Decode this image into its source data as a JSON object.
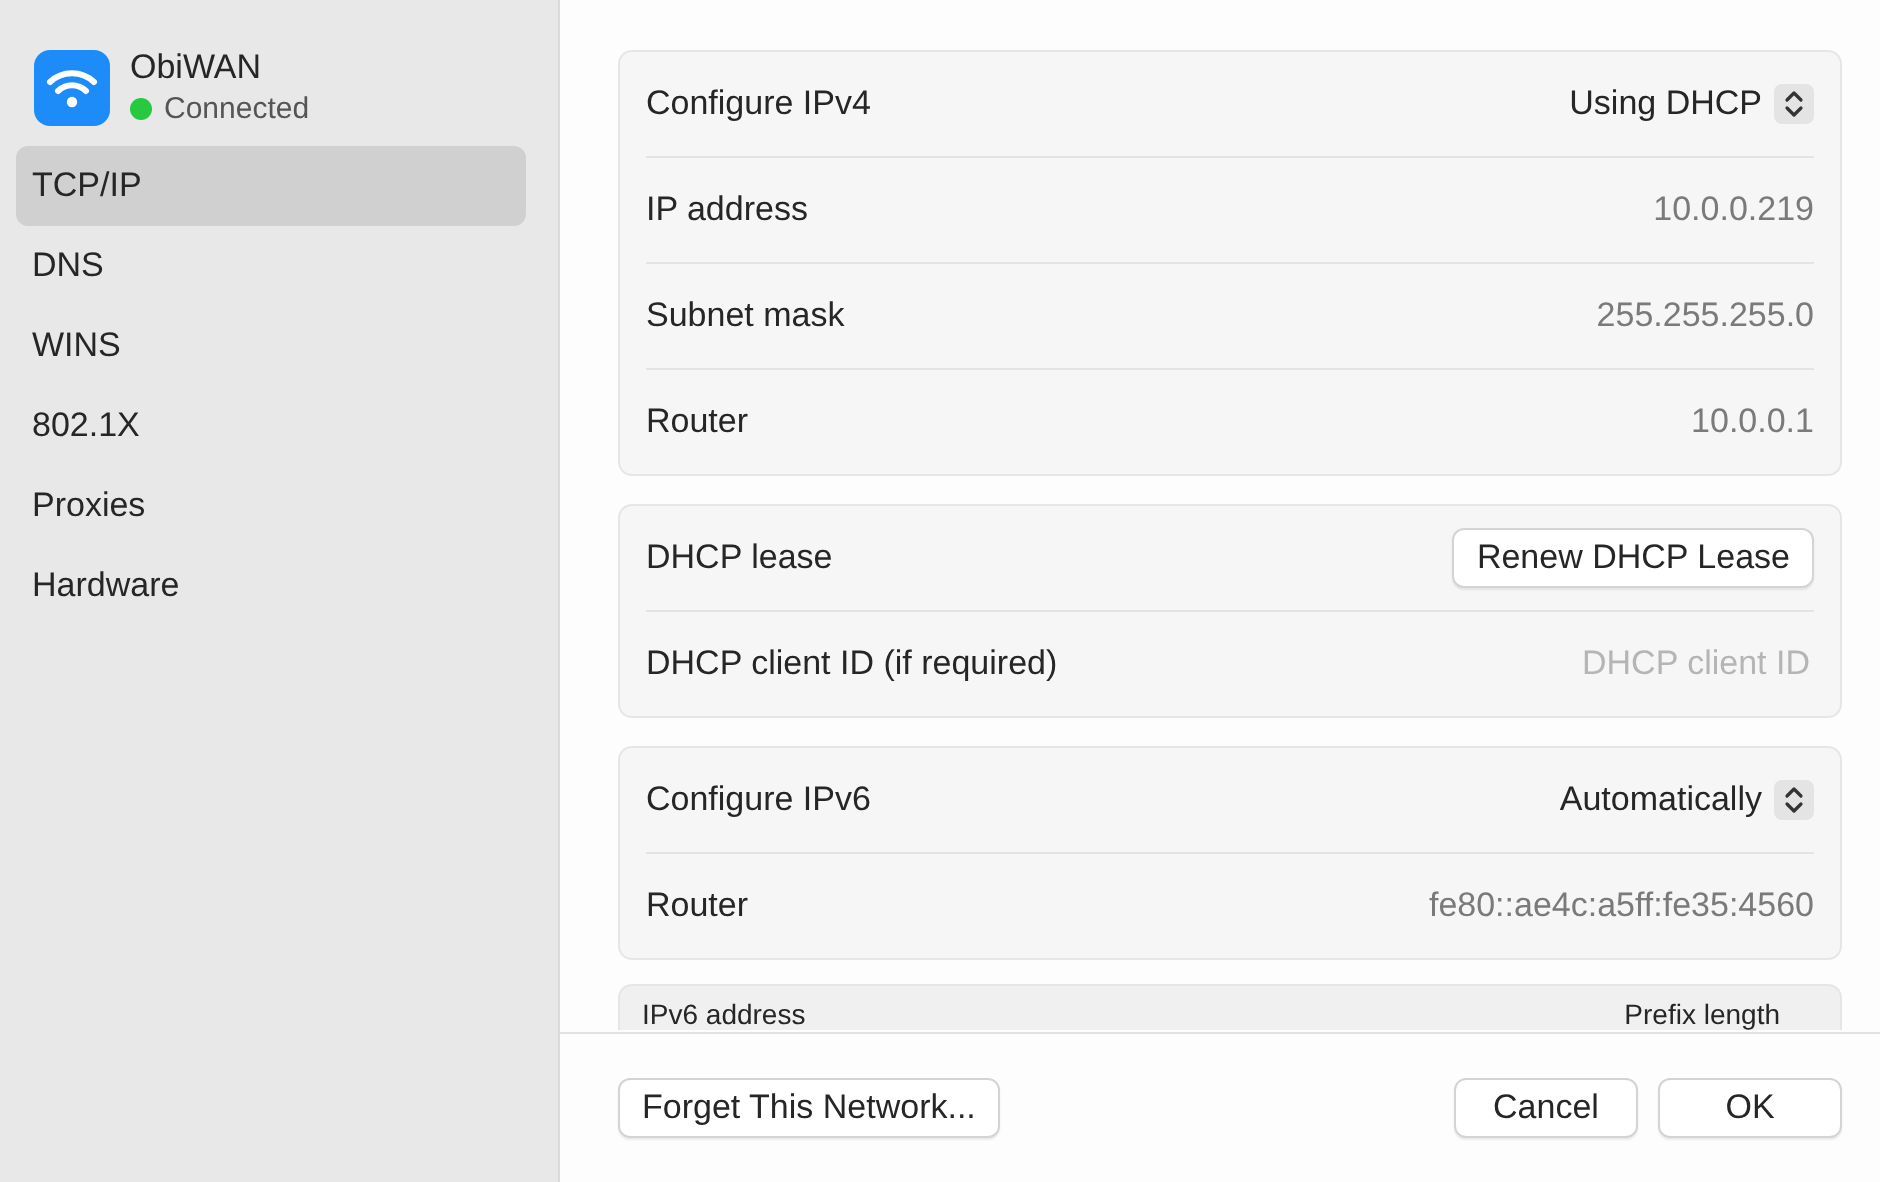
{
  "network": {
    "name": "ObiWAN",
    "status": "Connected",
    "connected": true
  },
  "sidebar": {
    "items": [
      {
        "label": "TCP/IP",
        "selected": true
      },
      {
        "label": "DNS",
        "selected": false
      },
      {
        "label": "WINS",
        "selected": false
      },
      {
        "label": "802.1X",
        "selected": false
      },
      {
        "label": "Proxies",
        "selected": false
      },
      {
        "label": "Hardware",
        "selected": false
      }
    ]
  },
  "sections": [
    {
      "rows": [
        {
          "kind": "popup",
          "label": "Configure IPv4",
          "value": "Using DHCP"
        },
        {
          "kind": "value",
          "label": "IP address",
          "value": "10.0.0.219"
        },
        {
          "kind": "value",
          "label": "Subnet mask",
          "value": "255.255.255.0"
        },
        {
          "kind": "value",
          "label": "Router",
          "value": "10.0.0.1"
        }
      ]
    },
    {
      "rows": [
        {
          "kind": "button",
          "label": "DHCP lease",
          "value": "Renew DHCP Lease"
        },
        {
          "kind": "field",
          "label": "DHCP client ID (if required)",
          "placeholder": "DHCP client ID"
        }
      ]
    },
    {
      "rows": [
        {
          "kind": "popup",
          "label": "Configure IPv6",
          "value": "Automatically"
        },
        {
          "kind": "value",
          "label": "Router",
          "value": "fe80::ae4c:a5ff:fe35:4560"
        }
      ]
    }
  ],
  "address_table": {
    "columns": [
      "IPv6 address",
      "Prefix length"
    ]
  },
  "footer": {
    "left_buttons": [
      "Forget This Network..."
    ],
    "right_buttons": [
      "Cancel",
      "OK"
    ]
  }
}
